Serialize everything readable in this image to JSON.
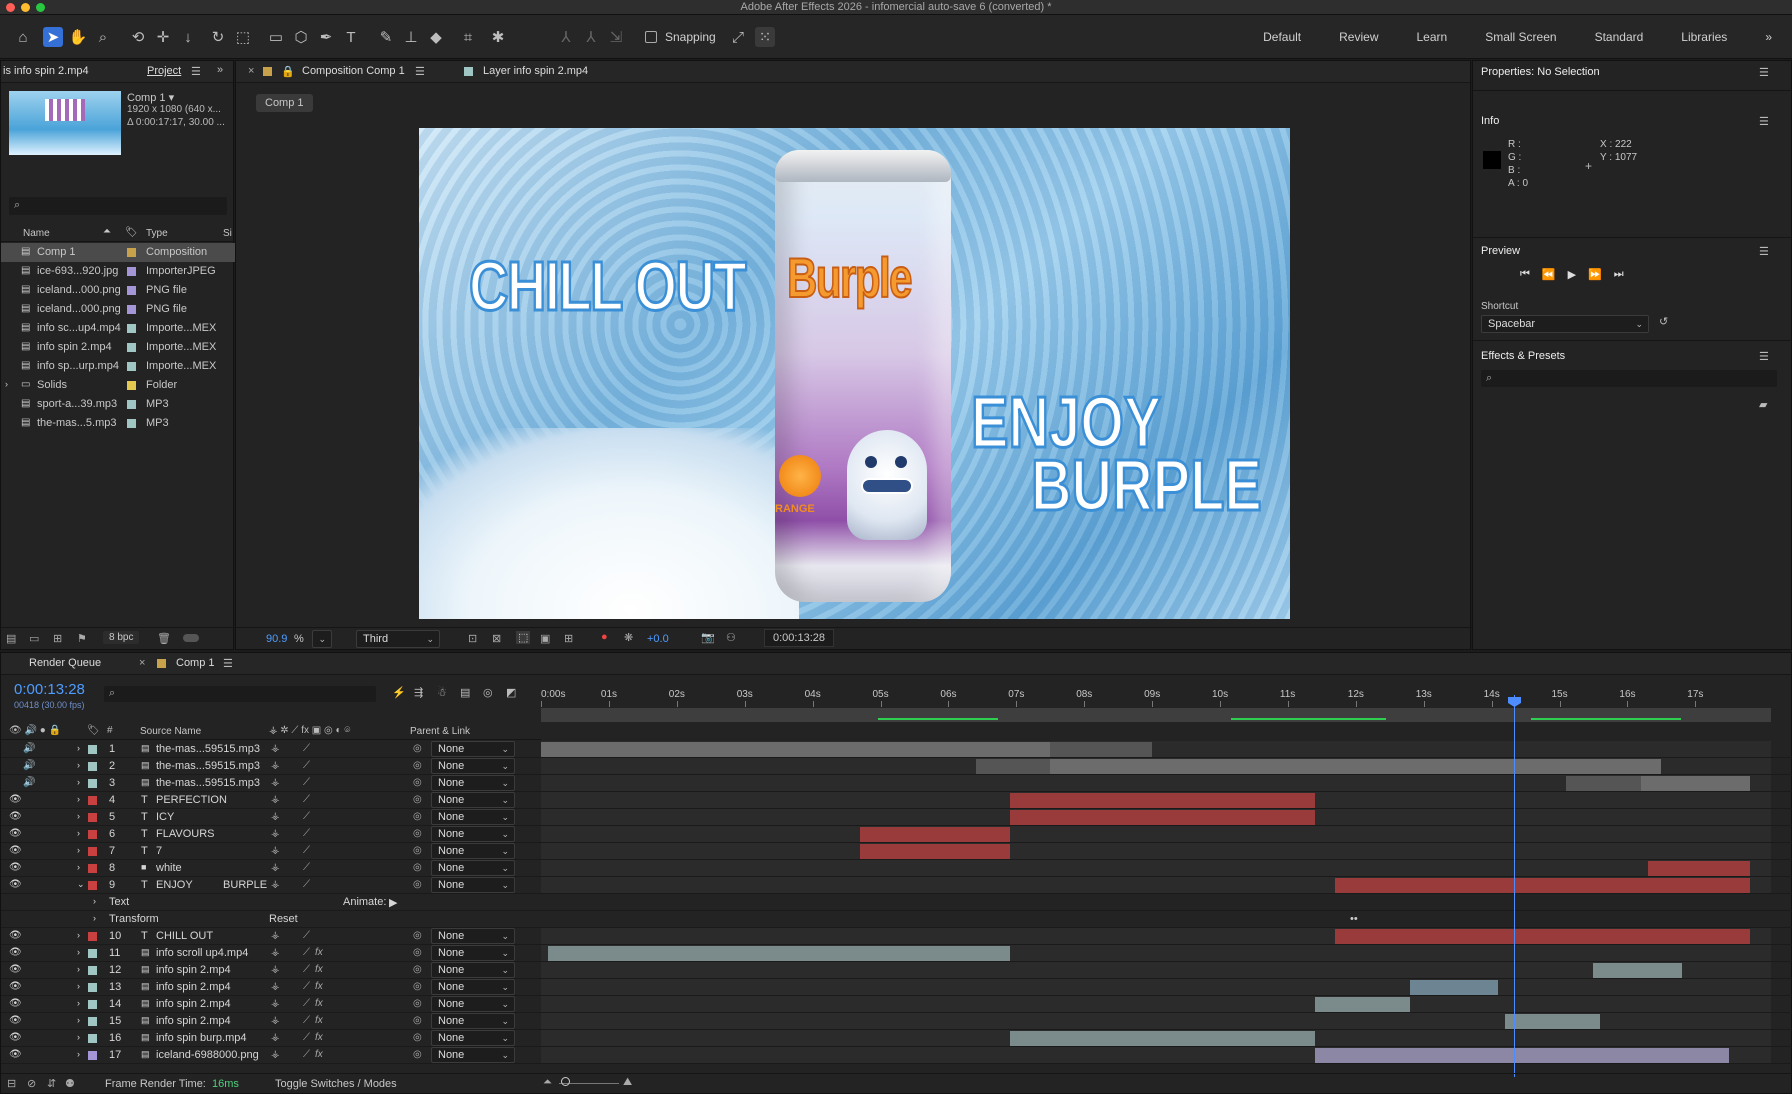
{
  "window": {
    "title": "Adobe After Effects 2026 - infomercial auto-save 6 (converted) *"
  },
  "toolbar": {
    "snapping": "Snapping",
    "workspaces": [
      "Default",
      "Review",
      "Learn",
      "Small Screen",
      "Standard",
      "Libraries"
    ]
  },
  "project": {
    "left_tab": "is info spin 2.mp4",
    "tab": "Project",
    "comp_name": "Comp 1 ▾",
    "comp_info": [
      "1920 x 1080  (640 x...",
      "Δ 0:00:17:17, 30.00 ..."
    ],
    "col_name": "Name",
    "col_type": "Type",
    "col_size": "Si",
    "items": [
      {
        "name": "Comp 1",
        "type": "Composition",
        "color": "#c7a24b"
      },
      {
        "name": "ice-693...920.jpg",
        "type": "ImporterJPEG",
        "color": "#a496d6"
      },
      {
        "name": "iceland...000.png",
        "type": "PNG file",
        "color": "#a496d6"
      },
      {
        "name": "iceland...000.png",
        "type": "PNG file",
        "color": "#a496d6"
      },
      {
        "name": "info sc...up4.mp4",
        "type": "Importe...MEX",
        "color": "#9fc6c2"
      },
      {
        "name": "info spin 2.mp4",
        "type": "Importe...MEX",
        "color": "#9fc6c2"
      },
      {
        "name": "info sp...urp.mp4",
        "type": "Importe...MEX",
        "color": "#9fc6c2"
      },
      {
        "name": "Solids",
        "type": "Folder",
        "color": "#e3c94f"
      },
      {
        "name": "sport-a...39.mp3",
        "type": "MP3",
        "color": "#9fc6c2"
      },
      {
        "name": "the-mas...5.mp3",
        "type": "MP3",
        "color": "#9fc6c2"
      }
    ],
    "bpc": "8 bpc"
  },
  "viewer": {
    "tab1": "Composition Comp 1",
    "tab2": "Layer info spin 2.mp4",
    "crumb": "Comp 1",
    "art": {
      "chill": "CHILL OUT",
      "enjoy": "ENJOY",
      "burple": "BURPLE",
      "brand": "Burple",
      "orange": "RANGE"
    },
    "zoom": "90.9",
    "pct": "%",
    "res": "Third",
    "exposure": "+0.0",
    "timecode": "0:00:13:28"
  },
  "right": {
    "properties": "Properties: No Selection",
    "info": "Info",
    "r": "R :",
    "g": "G :",
    "b": "B :",
    "a": "A :  0",
    "x": "X : 222",
    "y": "Y : 1077",
    "preview": "Preview",
    "shortcut": "Shortcut",
    "shortcut_val": "Spacebar",
    "effects": "Effects & Presets"
  },
  "timeline": {
    "render_queue": "Render Queue",
    "comp_tab": "Comp 1",
    "time": "0:00:13:28",
    "fps": "00418 (30.00 fps)",
    "col_src": "Source Name",
    "col_parent": "Parent & Link",
    "ruler": [
      "0:00s",
      "01s",
      "02s",
      "03s",
      "04s",
      "05s",
      "06s",
      "07s",
      "08s",
      "09s",
      "10s",
      "11s",
      "12s",
      "13s",
      "14s",
      "15s",
      "16s",
      "17s"
    ],
    "layers": [
      {
        "n": "1",
        "name": "the-mas...59515.mp3",
        "kind": "audio",
        "color": "#9fc6c2",
        "parent": "None",
        "bar": {
          "start": 0,
          "end": 7.5,
          "color": "#6c6c6c"
        },
        "bar2": {
          "start": 7.5,
          "end": 9,
          "color": "#555"
        }
      },
      {
        "n": "2",
        "name": "the-mas...59515.mp3",
        "kind": "audio",
        "color": "#9fc6c2",
        "parent": "None",
        "bar": {
          "start": 6.4,
          "end": 7.5,
          "color": "#555"
        },
        "bar2": {
          "start": 7.5,
          "end": 16.5,
          "color": "#6c6c6c"
        }
      },
      {
        "n": "3",
        "name": "the-mas...59515.mp3",
        "kind": "audio",
        "color": "#9fc6c2",
        "parent": "None",
        "bar": {
          "start": 15.1,
          "end": 16.2,
          "color": "#555"
        },
        "bar2": {
          "start": 16.2,
          "end": 17.8,
          "color": "#6c6c6c"
        }
      },
      {
        "n": "4",
        "name": "PERFECTION",
        "kind": "text",
        "color": "#c94040",
        "parent": "None",
        "bar": {
          "start": 6.9,
          "end": 11.4,
          "color": "#9a3b3b"
        }
      },
      {
        "n": "5",
        "name": "ICY",
        "kind": "text",
        "color": "#c94040",
        "parent": "None",
        "bar": {
          "start": 6.9,
          "end": 11.4,
          "color": "#9a3b3b"
        }
      },
      {
        "n": "6",
        "name": "FLAVOURS",
        "kind": "text",
        "color": "#c94040",
        "parent": "None",
        "bar": {
          "start": 4.7,
          "end": 6.9,
          "color": "#9a3b3b"
        }
      },
      {
        "n": "7",
        "name": "7",
        "kind": "text",
        "color": "#c94040",
        "parent": "None",
        "bar": {
          "start": 4.7,
          "end": 6.9,
          "color": "#9a3b3b"
        }
      },
      {
        "n": "8",
        "name": "white",
        "kind": "solid",
        "color": "#c94040",
        "parent": "None",
        "bar": {
          "start": 16.3,
          "end": 17.8,
          "color": "#9a3b3b"
        }
      },
      {
        "n": "9",
        "name": "ENJOY          BURPLE",
        "kind": "text",
        "color": "#c94040",
        "parent": "None",
        "bar": {
          "start": 11.7,
          "end": 17.8,
          "color": "#9a3b3b"
        },
        "expanded": true
      },
      {
        "n": "10",
        "name": "CHILL OUT",
        "kind": "text",
        "color": "#c94040",
        "parent": "None",
        "bar": {
          "start": 11.7,
          "end": 17.8,
          "color": "#9a3b3b"
        }
      },
      {
        "n": "11",
        "name": "info scroll up4.mp4",
        "kind": "video",
        "color": "#9fc6c2",
        "parent": "None",
        "bar": {
          "start": 0.1,
          "end": 6.9,
          "color": "#7b8a8a"
        }
      },
      {
        "n": "12",
        "name": "info spin 2.mp4",
        "kind": "video",
        "color": "#9fc6c2",
        "parent": "None",
        "bar": {
          "start": 15.5,
          "end": 16.8,
          "color": "#7b8a8a"
        }
      },
      {
        "n": "13",
        "name": "info spin 2.mp4",
        "kind": "video",
        "color": "#9fc6c2",
        "parent": "None",
        "bar": {
          "start": 12.8,
          "end": 14.1,
          "color": "#6d8592"
        }
      },
      {
        "n": "14",
        "name": "info spin 2.mp4",
        "kind": "video",
        "color": "#9fc6c2",
        "parent": "None",
        "bar": {
          "start": 11.4,
          "end": 12.8,
          "color": "#7b8a8a"
        }
      },
      {
        "n": "15",
        "name": "info spin 2.mp4",
        "kind": "video",
        "color": "#9fc6c2",
        "parent": "None",
        "bar": {
          "start": 14.2,
          "end": 15.6,
          "color": "#7b8a8a"
        }
      },
      {
        "n": "16",
        "name": "info spin burp.mp4",
        "kind": "video",
        "color": "#9fc6c2",
        "parent": "None",
        "bar": {
          "start": 6.9,
          "end": 11.4,
          "color": "#7b8a8a"
        }
      },
      {
        "n": "17",
        "name": "iceland-6988000.png",
        "kind": "image",
        "color": "#a496d6",
        "parent": "None",
        "bar": {
          "start": 11.4,
          "end": 17.5,
          "color": "#8b87a5"
        }
      }
    ],
    "sub_text": "Text",
    "sub_transform": "Transform",
    "animate": "Animate:",
    "reset": "Reset",
    "render_label": "Frame Render Time:",
    "render_time": "16ms",
    "toggle": "Toggle Switches / Modes"
  }
}
